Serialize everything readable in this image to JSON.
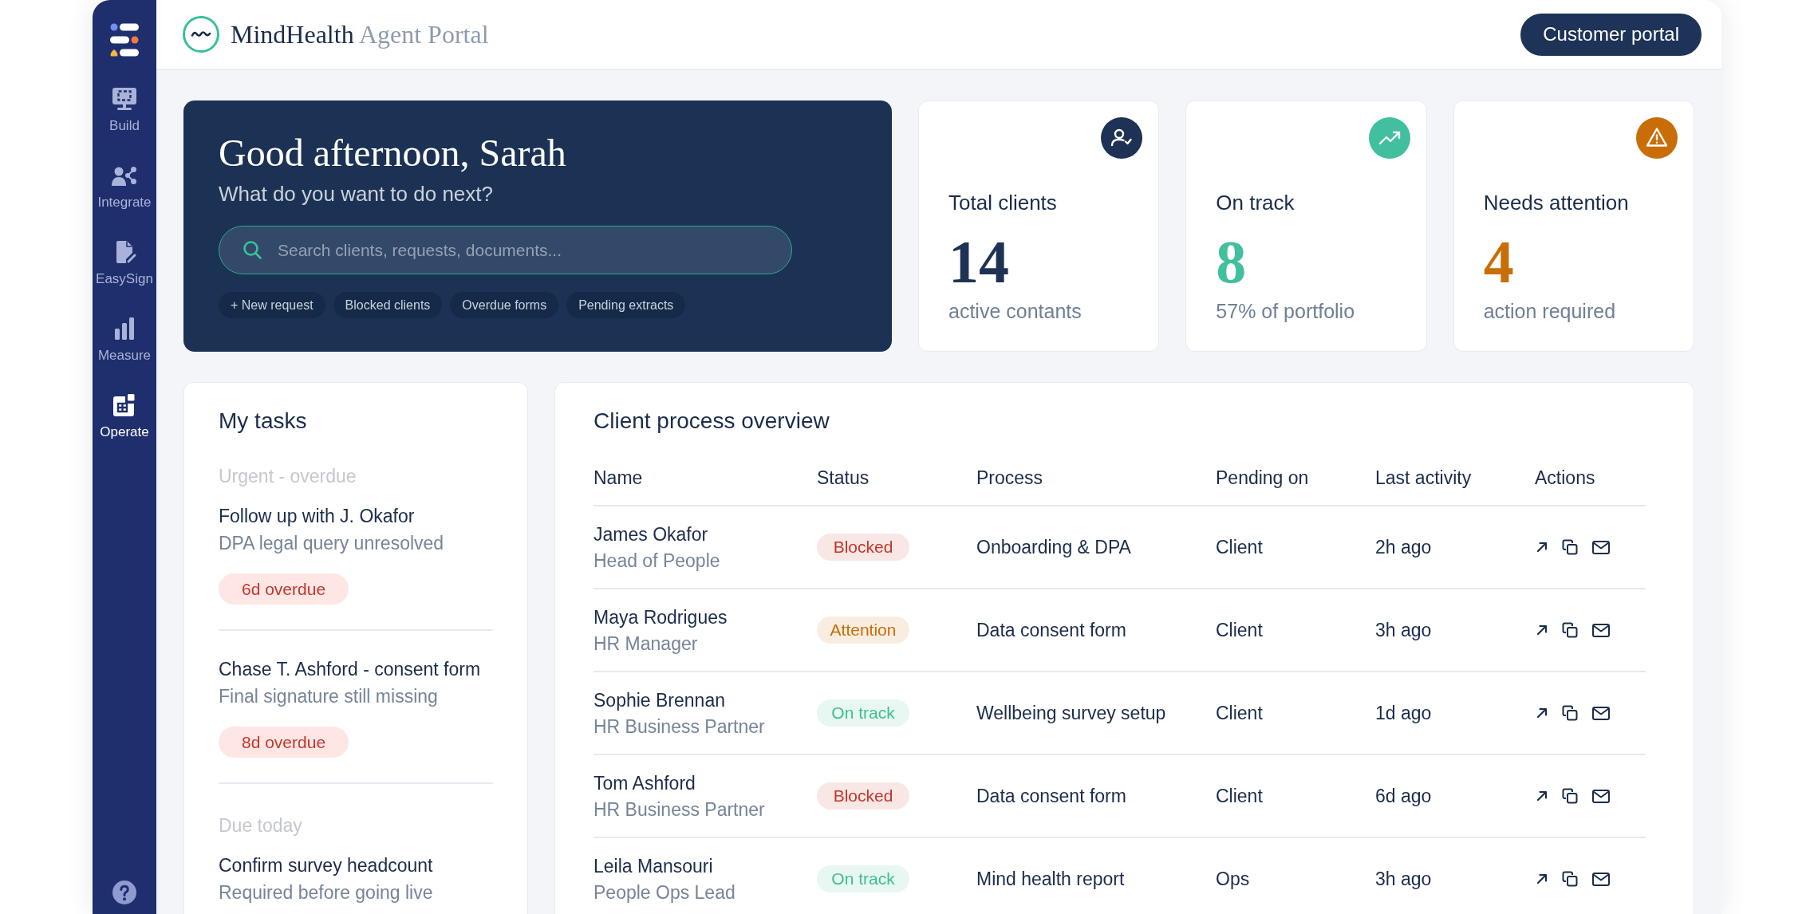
{
  "header": {
    "brand": "MindHealth",
    "brand_suffix": "Agent Portal",
    "portal_button": "Customer portal"
  },
  "sidebar": {
    "items": [
      {
        "label": "Build",
        "kind": "build",
        "selected": false
      },
      {
        "label": "Integrate",
        "kind": "integrate",
        "selected": false
      },
      {
        "label": "EasySign",
        "kind": "sign",
        "selected": false
      },
      {
        "label": "Measure",
        "kind": "measure",
        "selected": false
      },
      {
        "label": "Operate",
        "kind": "operate",
        "selected": true
      }
    ]
  },
  "hero": {
    "title": "Good afternoon, Sarah",
    "subtitle": "What do you want to do next?",
    "search": {
      "placeholder": "Search clients, requests, documents..."
    },
    "chips": [
      "+ New request",
      "Blocked clients",
      "Overdue forms",
      "Pending extracts"
    ]
  },
  "stats": [
    {
      "label": "Total clients",
      "value": "14",
      "caption": "active contants",
      "kind": "clients",
      "color": "#1e3255"
    },
    {
      "label": "On track",
      "value": "8",
      "caption": "57% of portfolio",
      "kind": "trend",
      "color": "#41bf9f"
    },
    {
      "label": "Needs attention",
      "value": "4",
      "caption": "action required",
      "kind": "warning",
      "color": "#c96d06"
    }
  ],
  "tasks": {
    "title": "My tasks",
    "groups": [
      {
        "heading": "Urgent - overdue",
        "items": [
          {
            "title": "Follow up with J. Okafor",
            "detail": "DPA legal query unresolved",
            "badge": "6d overdue"
          },
          {
            "title": "Chase T. Ashford - consent form",
            "detail": "Final signature still missing",
            "badge": "8d overdue"
          }
        ]
      },
      {
        "heading": "Due today",
        "items": [
          {
            "title": "Confirm survey headcount",
            "detail": "Required before going live"
          }
        ]
      }
    ]
  },
  "table": {
    "title": "Client process overview",
    "columns": [
      "Name",
      "Status",
      "Process",
      "Pending on",
      "Last activity",
      "Actions"
    ],
    "rows": [
      {
        "name": "James Okafor",
        "role": "Head of People",
        "status": {
          "label": "Blocked",
          "color": "#c4362a"
        },
        "process": "Onboarding & DPA",
        "pending_on": "Client",
        "last_activity": "2h ago"
      },
      {
        "name": "Maya Rodrigues",
        "role": "HR Manager",
        "status": {
          "label": "Attention",
          "color": "#c96d06"
        },
        "process": "Data consent form",
        "pending_on": "Client",
        "last_activity": "3h ago"
      },
      {
        "name": "Sophie Brennan",
        "role": "HR Business Partner",
        "status": {
          "label": "On track",
          "color": "#3dbf95"
        },
        "process": "Wellbeing survey setup",
        "pending_on": "Client",
        "last_activity": "1d ago"
      },
      {
        "name": "Tom Ashford",
        "role": "HR Business Partner",
        "status": {
          "label": "Blocked",
          "color": "#c4362a"
        },
        "process": "Data consent form",
        "pending_on": "Client",
        "last_activity": "6d ago"
      },
      {
        "name": "Leila Mansouri",
        "role": "People Ops Lead",
        "status": {
          "label": "On track",
          "color": "#3dbf95"
        },
        "process": "Mind health report",
        "pending_on": "Ops",
        "last_activity": "3h ago"
      }
    ]
  }
}
